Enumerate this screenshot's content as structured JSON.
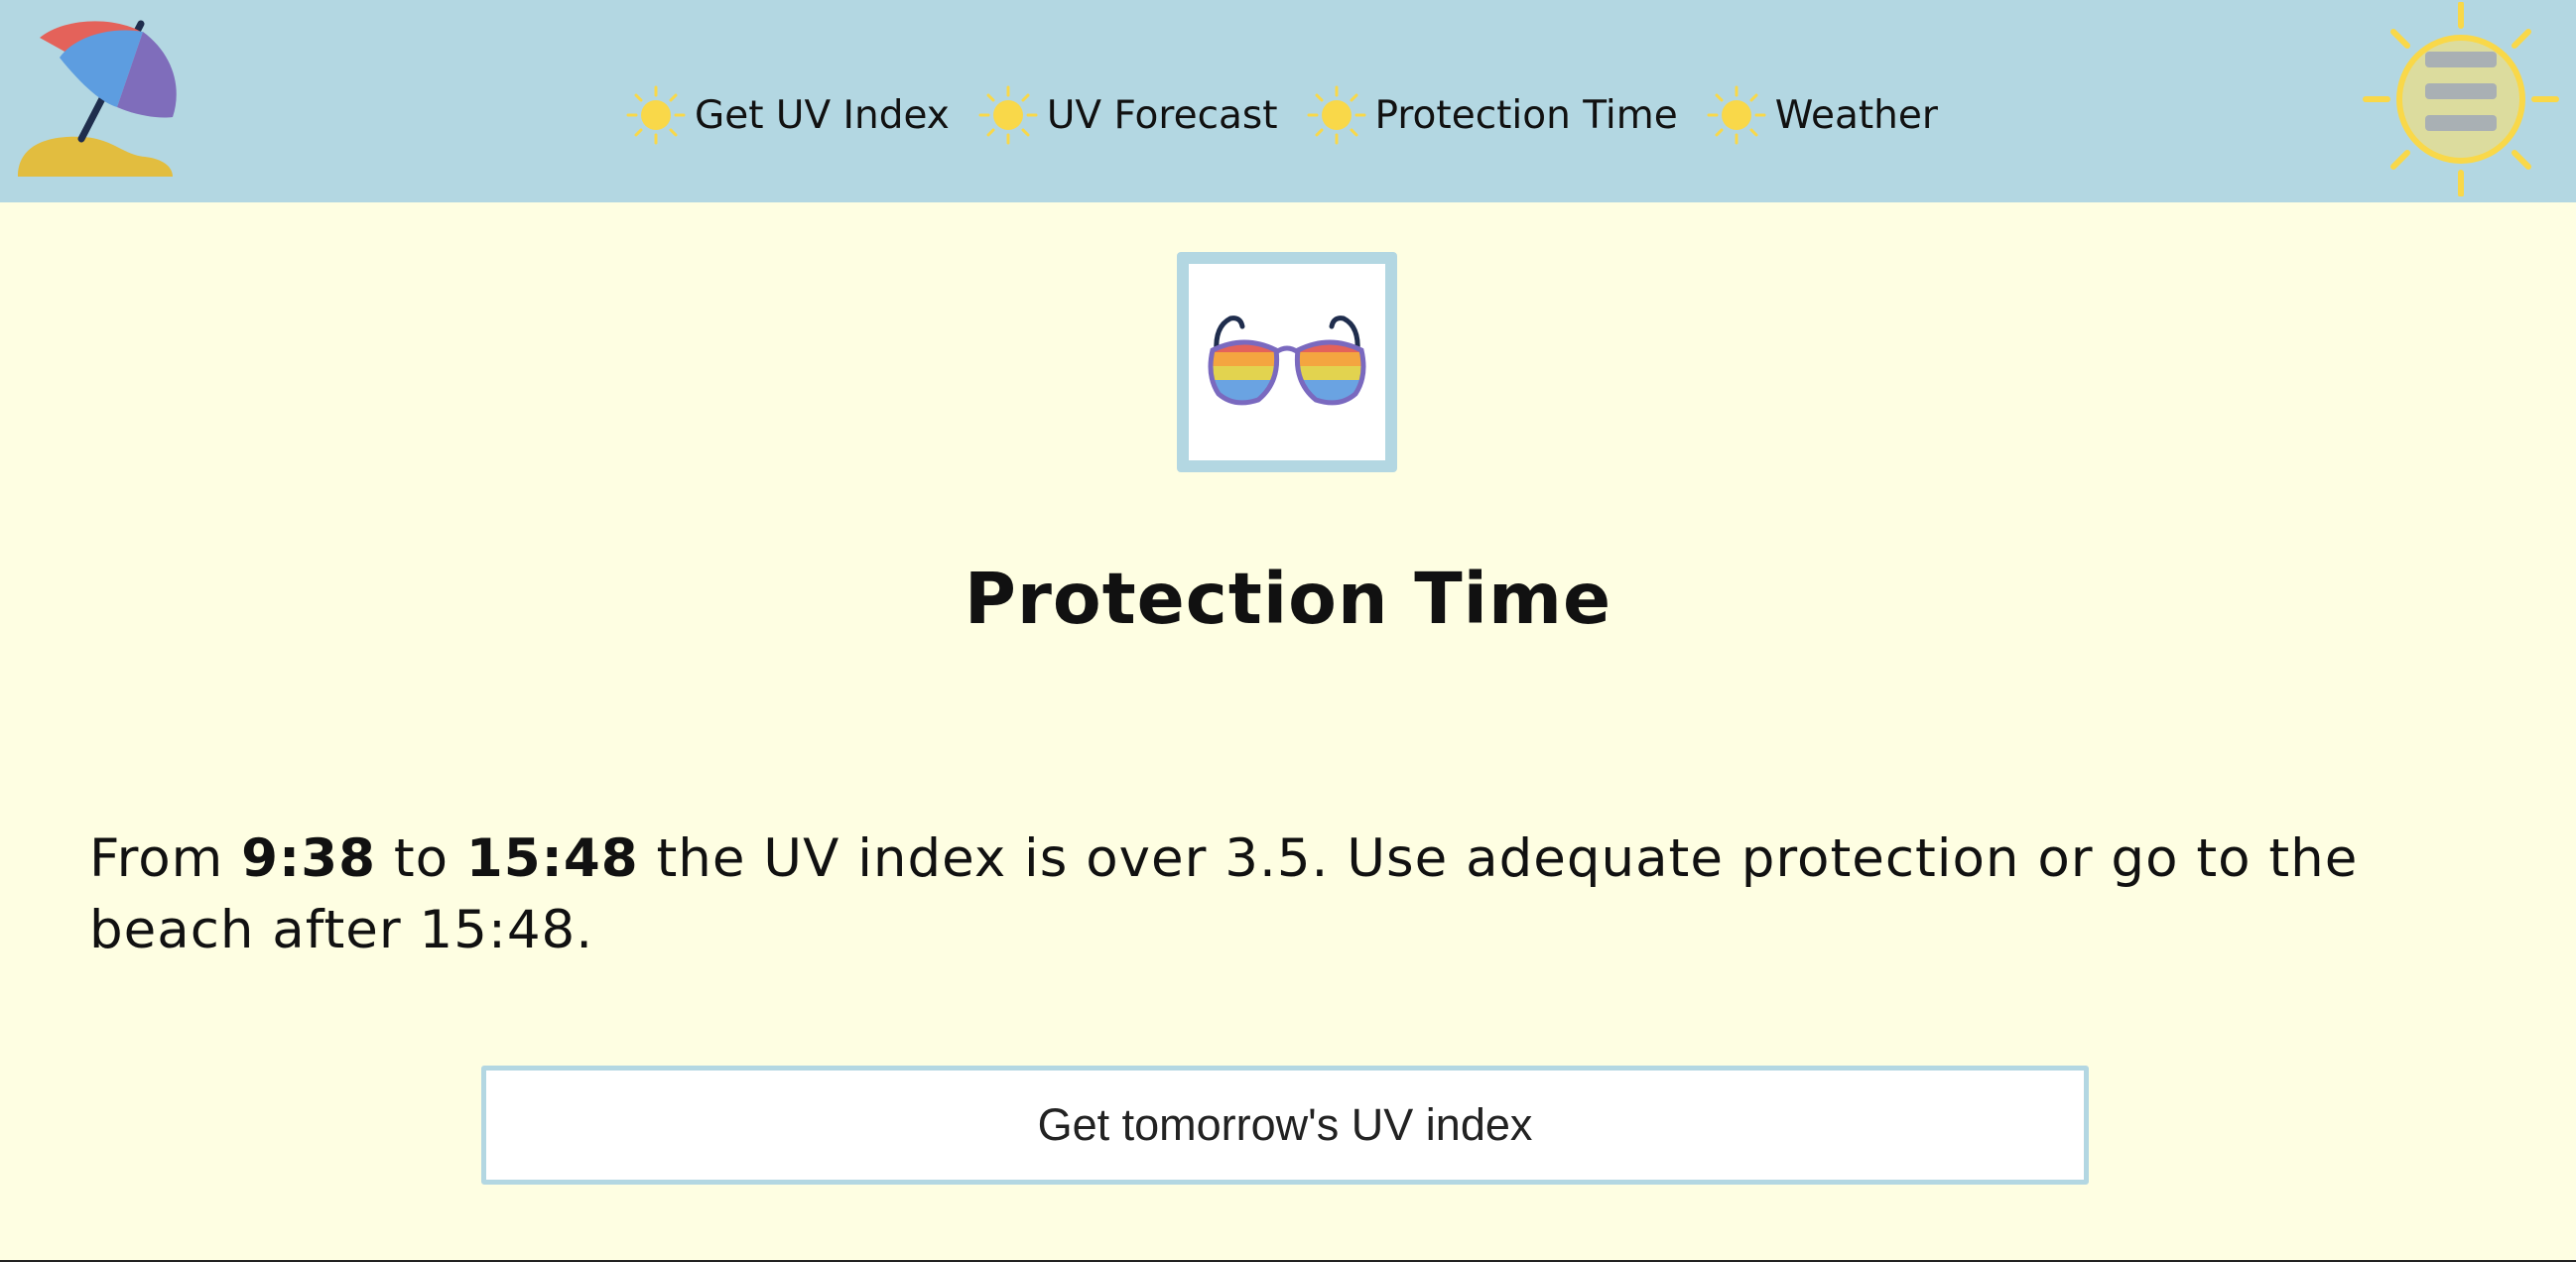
{
  "header": {
    "nav": [
      {
        "label": "Get UV Index"
      },
      {
        "label": "UV Forecast"
      },
      {
        "label": "Protection Time"
      },
      {
        "label": "Weather"
      }
    ]
  },
  "main": {
    "title": "Protection Time",
    "message": {
      "prefix": "From ",
      "start_time": "9:38",
      "middle": " to ",
      "end_time": "15:48",
      "suffix": " the UV index is over 3.5. Use adequate protection or go to the beach after 15:48."
    },
    "button_label": "Get tomorrow's UV index"
  },
  "icons": {
    "logo": "beach-umbrella-icon",
    "nav_bullet": "sun-icon",
    "menu": "sun-menu-icon",
    "feature": "sunglasses-icon"
  },
  "colors": {
    "header_bg": "#b3d7e2",
    "page_bg": "#fefee2",
    "sun": "#f9d849",
    "frame_border": "#b3d7e2"
  }
}
